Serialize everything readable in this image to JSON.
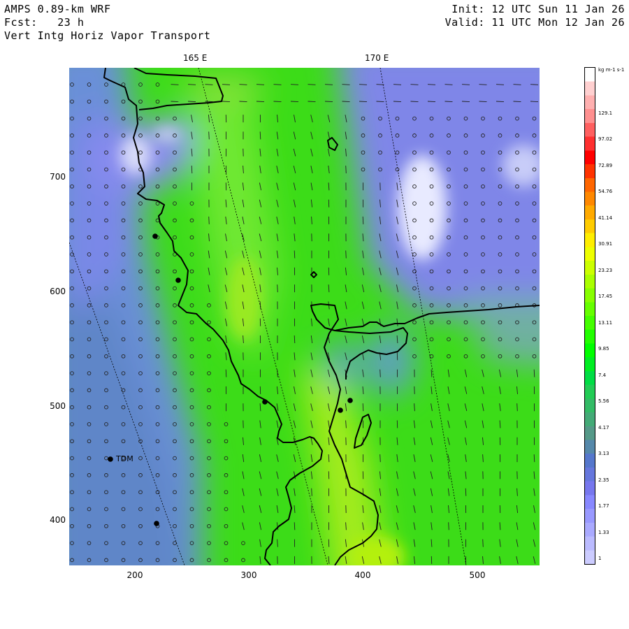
{
  "header": {
    "line1_left": "AMPS 0.89-km WRF",
    "line2_left": "Fcst:   23 h",
    "line3_left": "Vert Intg Horiz Vapor Transport",
    "line1_right": "Init: 12 UTC Sun 11 Jan 26",
    "line2_right": "Valid: 11 UTC Mon 12 Jan 26"
  },
  "longitude_labels": [
    "165 E",
    "170 E"
  ],
  "y_ticks": [
    "700",
    "600",
    "500",
    "400"
  ],
  "x_ticks": [
    "200",
    "300",
    "400",
    "500"
  ],
  "colorbar": {
    "units": "kg m-1 s-1",
    "labels": [
      "129.1",
      "97.02",
      "72.89",
      "54.76",
      "41.14",
      "30.91",
      "23.23",
      "17.45",
      "13.11",
      "9.85",
      "7.4",
      "5.56",
      "4.17",
      "3.13",
      "2.35",
      "1.77",
      "1.33",
      "1"
    ],
    "colors": [
      "#ffffff",
      "#ffd0d0",
      "#ffb0b0",
      "#ff9090",
      "#ff6060",
      "#ff3030",
      "#ff0000",
      "#ff3300",
      "#ff6600",
      "#ff8800",
      "#ffaa00",
      "#ffcc00",
      "#ffee00",
      "#eeff00",
      "#ccff00",
      "#aaff00",
      "#88ff00",
      "#66ff00",
      "#44ff00",
      "#22ff00",
      "#00ff00",
      "#00ee22",
      "#00dd44",
      "#22cc55",
      "#33bb66",
      "#44aa77",
      "#559988",
      "#5588aa",
      "#5577cc",
      "#6677dd",
      "#7777ee",
      "#8888ff",
      "#9999ff",
      "#aaaaff",
      "#bbbbff",
      "#ccccff"
    ]
  },
  "station": {
    "name": "TDM"
  }
}
